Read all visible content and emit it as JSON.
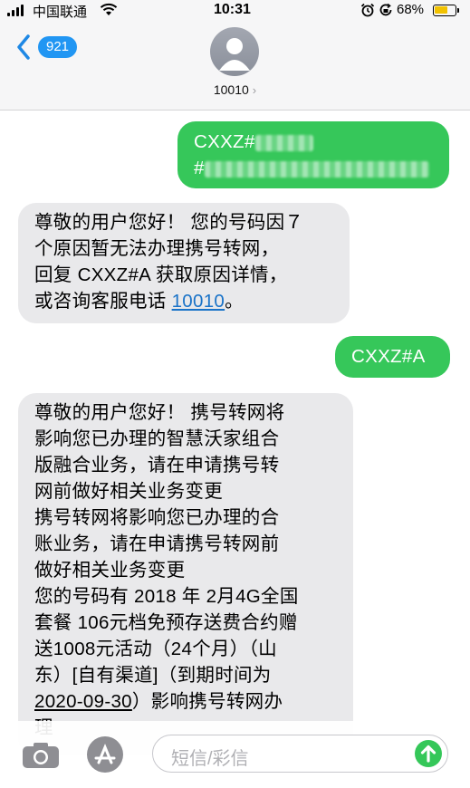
{
  "status_bar": {
    "carrier": "中国联通",
    "time": "10:31",
    "battery_percent": "68%",
    "battery_level": 0.68,
    "icons": [
      "signal-icon",
      "wifi-icon",
      "alarm-icon",
      "orientation-lock-icon",
      "battery-icon"
    ]
  },
  "nav": {
    "back_badge": "921",
    "contact_name": "10010",
    "chevron": "›"
  },
  "messages": [
    {
      "direction": "outgoing",
      "lines": [
        "CXXZ#",
        "#"
      ],
      "redacted": true
    },
    {
      "direction": "incoming",
      "lines": [
        "尊敬的用户您好！ 您的号码因７",
        "个原因暂无法办理携号转网，",
        "回复 CXXZ#A 获取原因详情，",
        "或咨询客服电话 "
      ],
      "link": "10010",
      "after_link": "。"
    },
    {
      "direction": "outgoing",
      "lines": [
        "CXXZ#A"
      ]
    },
    {
      "direction": "incoming",
      "lines": [
        "尊敬的用户您好！ 携号转网将",
        "影响您已办理的智慧沃家组合",
        "版融合业务，请在申请携号转",
        "网前做好相关业务变更",
        " 携号转网将影响您已办理的合",
        "账业务，请在申请携号转网前",
        "做好相关业务变更",
        " 您的号码有 2018 年 2月4G全国",
        "套餐 106元档免预存送费合约赠",
        "送1008元活动（24个月）（山",
        "东）[自有渠道]（到期时间为"
      ],
      "underlined_date": "2020-09-30",
      "tail": "）影响携号转网办",
      "last_line": "理"
    }
  ],
  "composer": {
    "placeholder": "短信/彩信"
  },
  "colors": {
    "incoming_bubble": "#e9e9eb",
    "outgoing_bubble": "#36c75a",
    "accent": "#2196f3",
    "link": "#1a73c8"
  }
}
